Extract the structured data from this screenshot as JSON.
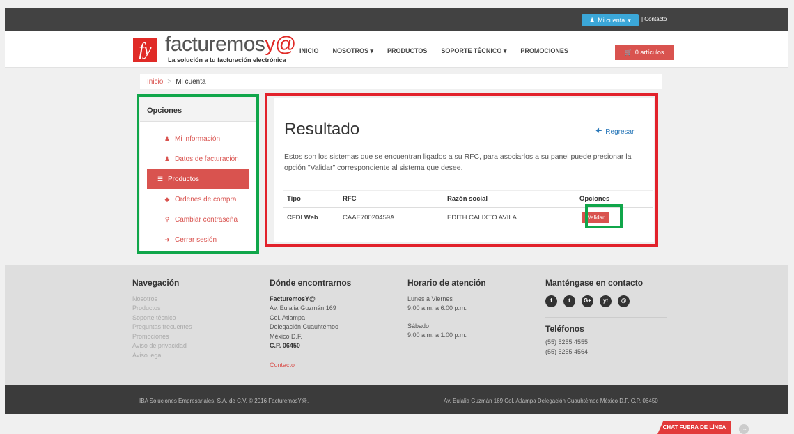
{
  "topbar": {
    "account_label": "Mi cuenta",
    "contact_label": "| Contacto"
  },
  "header": {
    "logo_mark": "fy",
    "logo_text_a": "facturemos",
    "logo_text_b": "y@",
    "tagline": "La solución a tu facturación electrónica",
    "nav": [
      "INICIO",
      "NOSOTROS ▾",
      "PRODUCTOS",
      "SOPORTE TÉCNICO ▾",
      "PROMOCIONES"
    ],
    "cart_label": "0 artículos"
  },
  "breadcrumb": {
    "home": "Inicio",
    "sep": ">",
    "current": "Mi cuenta"
  },
  "sidebar": {
    "title": "Opciones",
    "items": [
      {
        "label": "Mi información",
        "icon": "user-icon"
      },
      {
        "label": "Datos de facturación",
        "icon": "user-icon"
      },
      {
        "label": "Productos",
        "icon": "list-icon"
      },
      {
        "label": "Ordenes de compra",
        "icon": "tag-icon"
      },
      {
        "label": "Cambiar contraseña",
        "icon": "key-icon"
      },
      {
        "label": "Cerrar sesión",
        "icon": "signout-icon"
      }
    ]
  },
  "main": {
    "title": "Resultado",
    "back_label": "Regresar",
    "description": "Estos son los sistemas que se encuentran ligados a su RFC, para asociarlos a su panel puede presionar la opción \"Validar\" correspondiente al sistema que desee.",
    "table": {
      "headers": [
        "Tipo",
        "RFC",
        "Razón social",
        "Opciones"
      ],
      "rows": [
        {
          "tipo": "CFDI Web",
          "rfc": "CAAE70020459A",
          "razon": "EDITH CALIXTO AVILA",
          "action": "Validar"
        }
      ]
    }
  },
  "footer": {
    "nav": {
      "title": "Navegación",
      "links": [
        "Nosotros",
        "Productos",
        "Soporte técnico",
        "Preguntas frecuentes",
        "Promociones",
        "Aviso de privacidad",
        "Aviso legal"
      ]
    },
    "where": {
      "title": "Dónde encontrarnos",
      "name": "FacturemosY@",
      "lines": [
        "Av. Eulalia Guzmán 169",
        "Col. Atlampa",
        "Delegación Cuauhtémoc",
        "México D.F."
      ],
      "cp": "C.P. 06450",
      "contact": "Contacto"
    },
    "hours": {
      "title": "Horario de atención",
      "l1": "Lunes a Viernes",
      "l2": "9:00 a.m. a 6:00 p.m.",
      "l3": "Sábado",
      "l4": "9:00 a.m. a 1:00 p.m."
    },
    "contact": {
      "title": "Manténgase en contacto",
      "social": [
        "f",
        "t",
        "G+",
        "yt",
        "@"
      ],
      "phones_title": "Teléfonos",
      "phones": [
        "(55) 5255 4555",
        "(55) 5255 4564"
      ]
    }
  },
  "bottombar": {
    "left": "IBA Soluciones Empresariales, S.A. de C.V. © 2016 FacturemosY@.",
    "right": "Av. Eulalia Guzmán 169 Col. Atlampa Delegación Cuauhtémoc México D.F. C.P. 06450"
  },
  "chat": {
    "label": "CHAT FUERA DE LÍNEA",
    "dots": "···"
  },
  "colors": {
    "brand_red": "#e02b27",
    "accent_red": "#d9534f",
    "account_blue": "#3ba7d8",
    "highlight_green": "#10a64a",
    "highlight_red": "#e2222b"
  }
}
